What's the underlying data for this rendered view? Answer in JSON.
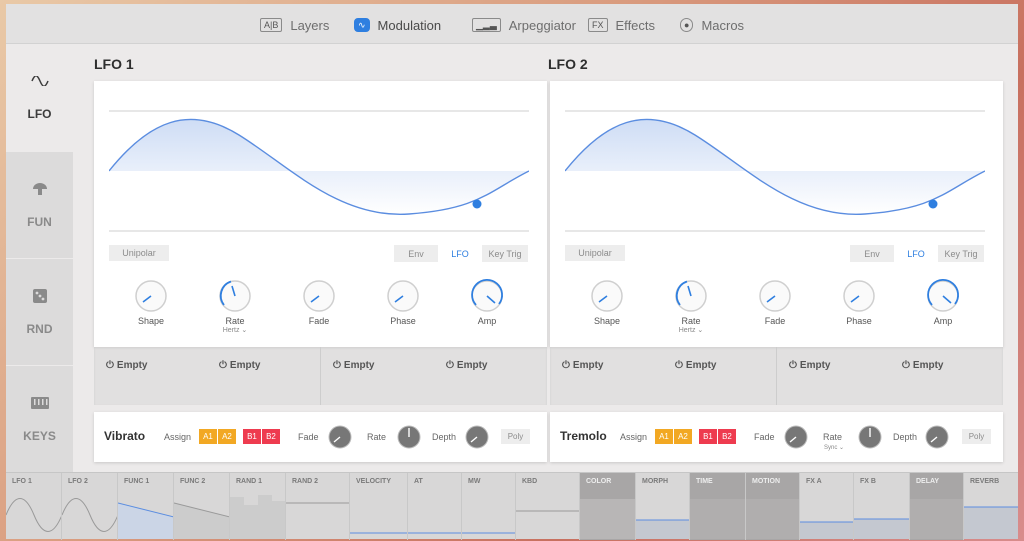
{
  "tabs": [
    {
      "icon": "A|B",
      "label": "Layers",
      "active": false
    },
    {
      "icon": "∿",
      "label": "Modulation",
      "active": true
    },
    {
      "icon": "▁▂▃",
      "label": "Arpeggiator",
      "active": false
    },
    {
      "icon": "FX",
      "label": "Effects",
      "active": false
    },
    {
      "icon": "●",
      "label": "Macros",
      "active": false
    }
  ],
  "sidebar": [
    {
      "label": "LFO",
      "icon": "sine-wave-icon",
      "active": true
    },
    {
      "label": "FUN",
      "icon": "mushroom-icon",
      "active": false
    },
    {
      "label": "RND",
      "icon": "dice-icon",
      "active": false
    },
    {
      "label": "KEYS",
      "icon": "keyboard-icon",
      "active": false
    }
  ],
  "lfos": [
    {
      "title": "LFO 1",
      "unipolar": "Unipolar",
      "modes": [
        "Env",
        "LFO",
        "Key Trig"
      ],
      "active_mode": "LFO",
      "knobs": [
        {
          "label": "Shape",
          "sub": "",
          "value": 0.2
        },
        {
          "label": "Rate",
          "sub": "Hertz ⌄",
          "value": 0.45
        },
        {
          "label": "Fade",
          "sub": "",
          "value": 0.2
        },
        {
          "label": "Phase",
          "sub": "",
          "value": 0.2
        },
        {
          "label": "Amp",
          "sub": "",
          "value": 0.9
        }
      ],
      "slots": [
        "Empty",
        "Empty",
        "Empty",
        "Empty"
      ],
      "fx": {
        "name": "Vibrato",
        "assign_label": "Assign",
        "assign": [
          "A1",
          "A2",
          "B1",
          "B2"
        ],
        "fade_label": "Fade",
        "rate_label": "Rate",
        "rate_sub": "",
        "depth_label": "Depth",
        "poly": "Poly"
      }
    },
    {
      "title": "LFO 2",
      "unipolar": "Unipolar",
      "modes": [
        "Env",
        "LFO",
        "Key Trig"
      ],
      "active_mode": "LFO",
      "knobs": [
        {
          "label": "Shape",
          "sub": "",
          "value": 0.2
        },
        {
          "label": "Rate",
          "sub": "Hertz ⌄",
          "value": 0.45
        },
        {
          "label": "Fade",
          "sub": "",
          "value": 0.2
        },
        {
          "label": "Phase",
          "sub": "",
          "value": 0.2
        },
        {
          "label": "Amp",
          "sub": "",
          "value": 0.9
        }
      ],
      "slots": [
        "Empty",
        "Empty",
        "Empty",
        "Empty"
      ],
      "fx": {
        "name": "Tremolo",
        "assign_label": "Assign",
        "assign": [
          "A1",
          "A2",
          "B1",
          "B2"
        ],
        "fade_label": "Fade",
        "rate_label": "Rate",
        "rate_sub": "Sync ⌄",
        "depth_label": "Depth",
        "poly": "Poly"
      }
    }
  ],
  "bottom_sources": [
    {
      "label": "LFO 1",
      "kind": "sine"
    },
    {
      "label": "LFO 2",
      "kind": "sine"
    },
    {
      "label": "FUNC 1",
      "kind": "ramp"
    },
    {
      "label": "FUNC 2",
      "kind": "ramp"
    },
    {
      "label": "RAND 1",
      "kind": "steps"
    },
    {
      "label": "RAND 2",
      "kind": "flat"
    },
    {
      "label": "VELOCITY",
      "kind": "low"
    },
    {
      "label": "AT",
      "kind": "low"
    },
    {
      "label": "MW",
      "kind": "low"
    },
    {
      "label": "KBD",
      "kind": "mid"
    },
    {
      "label": "COLOR",
      "kind": "fill"
    },
    {
      "label": "MORPH",
      "kind": "low"
    },
    {
      "label": "TIME",
      "kind": "fill"
    },
    {
      "label": "MOTION",
      "kind": "fill"
    },
    {
      "label": "FX A",
      "kind": "low"
    },
    {
      "label": "FX B",
      "kind": "low"
    },
    {
      "label": "DELAY",
      "kind": "fill"
    },
    {
      "label": "REVERB",
      "kind": "mid"
    }
  ],
  "colors": {
    "accent": "#2f7fe0",
    "assign_a": "#f2a823",
    "assign_b": "#ee3b4f"
  }
}
